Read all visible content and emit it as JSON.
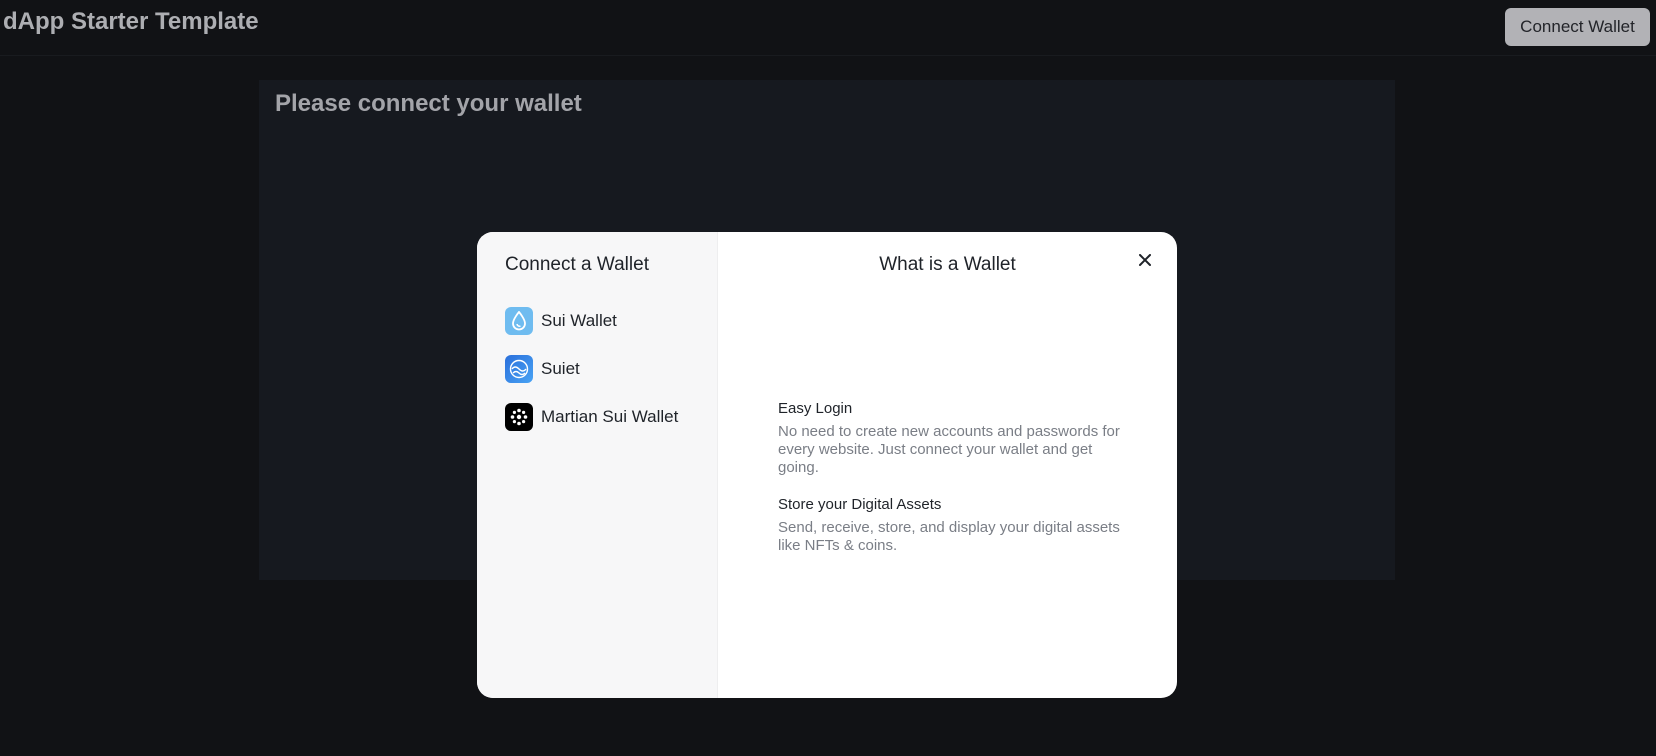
{
  "header": {
    "app_title": "dApp Starter Template",
    "connect_button_label": "Connect Wallet"
  },
  "main": {
    "title": "Please connect your wallet"
  },
  "modal": {
    "left_title": "Connect a Wallet",
    "wallets": [
      {
        "label": "Sui Wallet",
        "icon": "sui-drop-icon"
      },
      {
        "label": "Suiet",
        "icon": "suiet-waves-icon"
      },
      {
        "label": "Martian Sui Wallet",
        "icon": "martian-icon"
      }
    ],
    "right_title": "What is a Wallet",
    "close_icon": "close-icon",
    "features": [
      {
        "title": "Easy Login",
        "description": "No need to create new accounts and passwords for every website. Just connect your wallet and get going."
      },
      {
        "title": "Store your Digital Assets",
        "description": "Send, receive, store, and display your digital assets like NFTs & coins."
      }
    ]
  },
  "colors": {
    "background": "#15161a",
    "card": "#1c1f27",
    "modal": "#ffffff",
    "modal_sidebar": "#f7f7f8",
    "button": "#d9dadf"
  }
}
